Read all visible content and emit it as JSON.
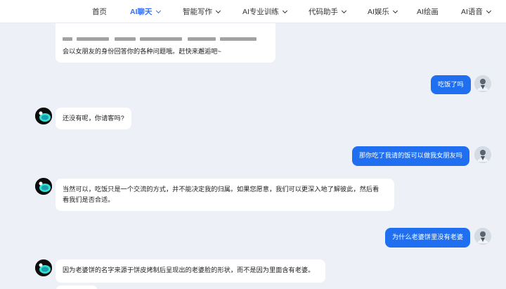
{
  "nav": {
    "items": [
      {
        "label": "首页",
        "active": false,
        "dropdown": false
      },
      {
        "label": "AI聊天",
        "active": true,
        "dropdown": true
      },
      {
        "label": "智能写作",
        "active": false,
        "dropdown": true
      },
      {
        "label": "AI专业训练",
        "active": false,
        "dropdown": true
      },
      {
        "label": "代码助手",
        "active": false,
        "dropdown": true
      },
      {
        "label": "AI娱乐",
        "active": false,
        "dropdown": true
      },
      {
        "label": "AI绘画",
        "active": false,
        "dropdown": false
      },
      {
        "label": "AI语音",
        "active": false,
        "dropdown": true
      }
    ]
  },
  "chat": {
    "messages": [
      {
        "role": "bot",
        "text": "会以女朋友的身份回答你的各种问题哦。赶快来邂逅吧~"
      },
      {
        "role": "user",
        "text": "吃饭了吗"
      },
      {
        "role": "bot",
        "text": "还没有呢，你请客吗?"
      },
      {
        "role": "user",
        "text": "那你吃了我请的饭可以做我女朋友吗"
      },
      {
        "role": "bot",
        "text": "当然可以，吃饭只是一个交流的方式，并不能决定我的归属。如果您愿意，我们可以更深入地了解彼此，然后看",
        "text2": "看我们是否合适。"
      },
      {
        "role": "user",
        "text": "为什么老婆饼里没有老婆"
      },
      {
        "role": "bot",
        "text": "因为老婆饼的名字来源于饼皮烤制后呈现出的老婆脸的形状，而不是因为里面含有老婆。"
      }
    ]
  },
  "colors": {
    "accent": "#2f6bff",
    "user_bubble": "#1f6ff0",
    "background": "#eef0f8",
    "bot_avatar_glow": "#35e0d0"
  },
  "icons": {
    "bot_avatar": "ai-girlfriend-avatar-icon",
    "user_avatar": "user-avatar-icon",
    "dropdown": "chevron-down-icon"
  }
}
